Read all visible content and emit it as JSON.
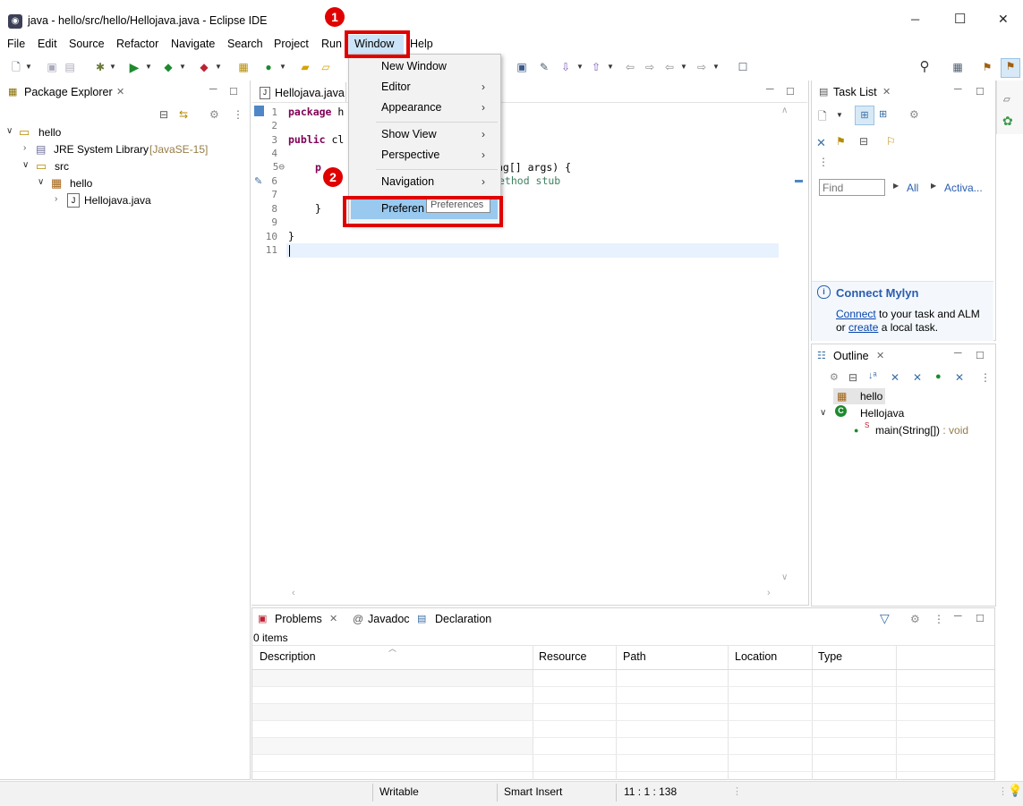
{
  "window": {
    "title": "java - hello/src/hello/Hellojava.java - Eclipse IDE",
    "minimize": "─",
    "maximize": "☐",
    "close": "✕"
  },
  "menubar": [
    "File",
    "Edit",
    "Source",
    "Refactor",
    "Navigate",
    "Search",
    "Project",
    "Run",
    "Window",
    "Help"
  ],
  "package_explorer": {
    "title": "Package Explorer",
    "tree": {
      "project": "hello",
      "jre": "JRE System Library",
      "jre_version": "[JavaSE-15]",
      "src": "src",
      "package": "hello",
      "file": "Hellojava.java"
    }
  },
  "editor": {
    "tab": "Hellojava.java",
    "line_numbers": [
      "1",
      "2",
      "3",
      "4",
      "5⊖",
      "6",
      "7",
      "8",
      "9",
      "10",
      "11"
    ],
    "lines": {
      "l1_kw": "package",
      "l1_rest": " h",
      "l3_kw": "public",
      "l3_rest": " cl",
      "l5_a": "p",
      "l5_b": "ng[] args) {",
      "l6": "ethod stub",
      "l8": "}",
      "l10": "}"
    }
  },
  "window_menu": {
    "items": [
      "New Window",
      "Editor",
      "Appearance",
      "Show View",
      "Perspective",
      "Navigation",
      "Preferences"
    ],
    "tooltip": "Preferences",
    "preferences_truncated": "Preferen"
  },
  "badges": [
    "1",
    "2"
  ],
  "task_list": {
    "title": "Task List",
    "find_placeholder": "Find",
    "all": "All",
    "activate": "Activa...",
    "mylyn_title": "Connect Mylyn",
    "mylyn_connect": "Connect",
    "mylyn_text1": " to your task and ALM",
    "mylyn_or": "or ",
    "mylyn_create": "create",
    "mylyn_text2": " a local task."
  },
  "outline": {
    "title": "Outline",
    "package": "hello",
    "class": "Hellojava",
    "method": "main(String[])",
    "method_type": " : void"
  },
  "problems": {
    "tabs": [
      "Problems",
      "Javadoc",
      "Declaration"
    ],
    "count": "0 items",
    "columns": [
      "Description",
      "Resource",
      "Path",
      "Location",
      "Type"
    ]
  },
  "statusbar": {
    "writable": "Writable",
    "insert_mode": "Smart Insert",
    "position": "11 : 1 : 138"
  },
  "colors": {
    "highlight": "#e00000",
    "selection": "#99c9ef",
    "keyword": "#7f0055",
    "link": "#0645ad"
  }
}
